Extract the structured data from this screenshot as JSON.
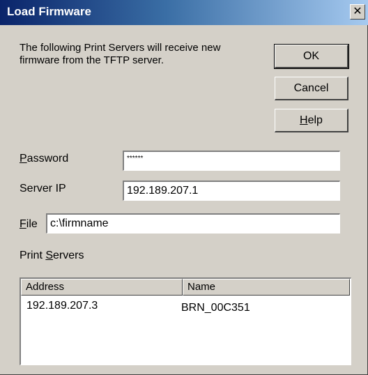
{
  "window": {
    "title": "Load Firmware",
    "close_glyph": "✕"
  },
  "intro_text": "The following Print Servers will receive new firmware from the TFTP server.",
  "buttons": {
    "ok": "OK",
    "cancel": "Cancel",
    "help": "Help"
  },
  "fields": {
    "password": {
      "label": "Password",
      "value": "******"
    },
    "server_ip": {
      "label": "Server IP",
      "value": "192.189.207.1"
    },
    "file": {
      "label": "File",
      "value": "c:\\firmname"
    }
  },
  "print_servers": {
    "label": "Print Servers",
    "columns": [
      "Address",
      "Name"
    ],
    "rows": [
      {
        "address": "192.189.207.3",
        "name": "BRN_00C351"
      }
    ]
  }
}
